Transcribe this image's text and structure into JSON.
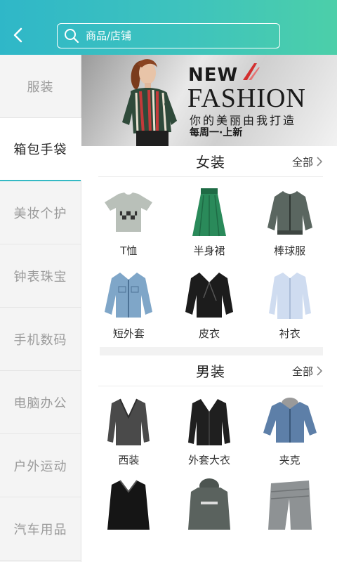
{
  "header": {
    "search_placeholder": "商品/店铺"
  },
  "sidebar": {
    "items": [
      {
        "label": "服装"
      },
      {
        "label": "箱包手袋",
        "active": true
      },
      {
        "label": "美妆个护"
      },
      {
        "label": "钟表珠宝"
      },
      {
        "label": "手机数码"
      },
      {
        "label": "电脑办公"
      },
      {
        "label": "户外运动"
      },
      {
        "label": "汽车用品"
      }
    ]
  },
  "banner": {
    "new": "NEW",
    "fashion": "FASHION",
    "line1": "你的美丽由我打造",
    "line2": "每周一·上新"
  },
  "sections": [
    {
      "title": "女装",
      "all": "全部",
      "items": [
        {
          "label": "T恤",
          "icon": "tshirt-icon"
        },
        {
          "label": "半身裙",
          "icon": "skirt-icon"
        },
        {
          "label": "棒球服",
          "icon": "baseball-jacket-icon"
        },
        {
          "label": "短外套",
          "icon": "denim-jacket-icon"
        },
        {
          "label": "皮衣",
          "icon": "leather-jacket-icon"
        },
        {
          "label": "衬衣",
          "icon": "shirt-icon"
        }
      ]
    },
    {
      "title": "男装",
      "all": "全部",
      "items": [
        {
          "label": "西装",
          "icon": "suit-icon"
        },
        {
          "label": "外套大衣",
          "icon": "coat-icon"
        },
        {
          "label": "夹克",
          "icon": "jacket-icon"
        },
        {
          "label": "",
          "icon": "leather-coat-icon"
        },
        {
          "label": "",
          "icon": "hoodie-icon"
        },
        {
          "label": "",
          "icon": "trousers-icon"
        }
      ]
    }
  ],
  "colors": {
    "header_start": "#2fb7c8",
    "header_end": "#4ccfa9",
    "active_underline": "#34b9c4"
  }
}
